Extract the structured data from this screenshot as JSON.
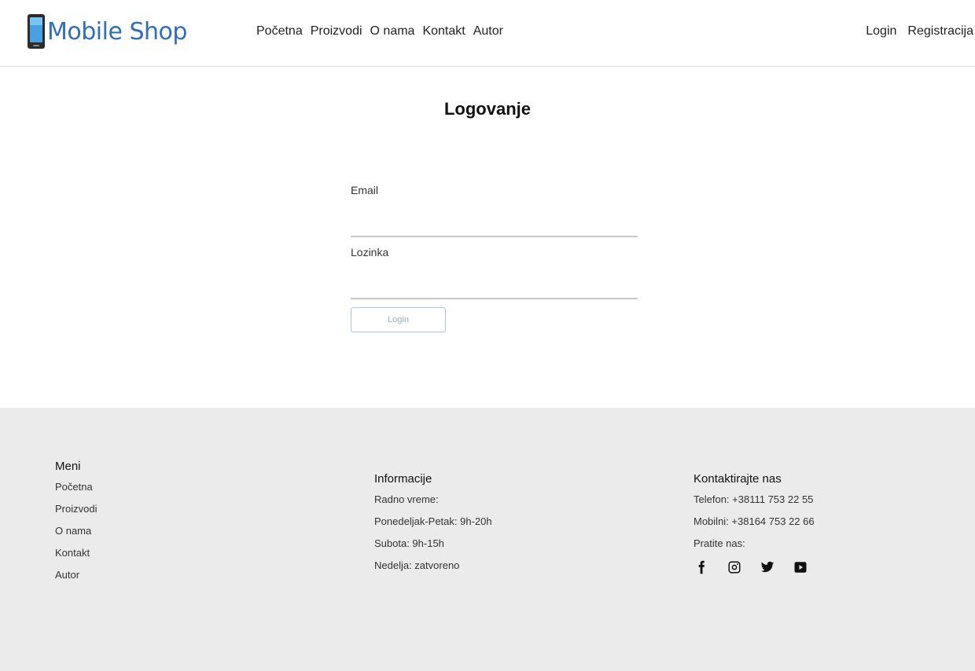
{
  "header": {
    "logo_text": "Mobile Shop",
    "nav": [
      "Početna",
      "Proizvodi",
      "O nama",
      "Kontakt",
      "Autor"
    ],
    "auth": {
      "login": "Login",
      "register": "Registracija"
    }
  },
  "form": {
    "title": "Logovanje",
    "email_label": "Email",
    "email_value": "",
    "password_label": "Lozinka",
    "password_value": "",
    "submit_label": "Login"
  },
  "footer": {
    "menu": {
      "title": "Meni",
      "items": [
        "Početna",
        "Proizvodi",
        "O nama",
        "Kontakt",
        "Autor"
      ]
    },
    "info": {
      "title": "Informacije",
      "lines": [
        "Radno vreme:",
        "Ponedeljak-Petak: 9h-20h",
        "Subota: 9h-15h",
        "Nedelja: zatvoreno"
      ]
    },
    "contact": {
      "title": "Kontaktirajte nas",
      "phone": "Telefon: +38111 753 22 55",
      "mobile": "Mobilni: +38164 753 22 66",
      "follow": "Pratite nas:",
      "socials": [
        "facebook-icon",
        "instagram-icon",
        "twitter-icon",
        "youtube-icon"
      ]
    }
  },
  "colors": {
    "brand": "#2f6fb8",
    "footer_bg": "#ebebeb",
    "button_border": "#a9c6e3"
  }
}
